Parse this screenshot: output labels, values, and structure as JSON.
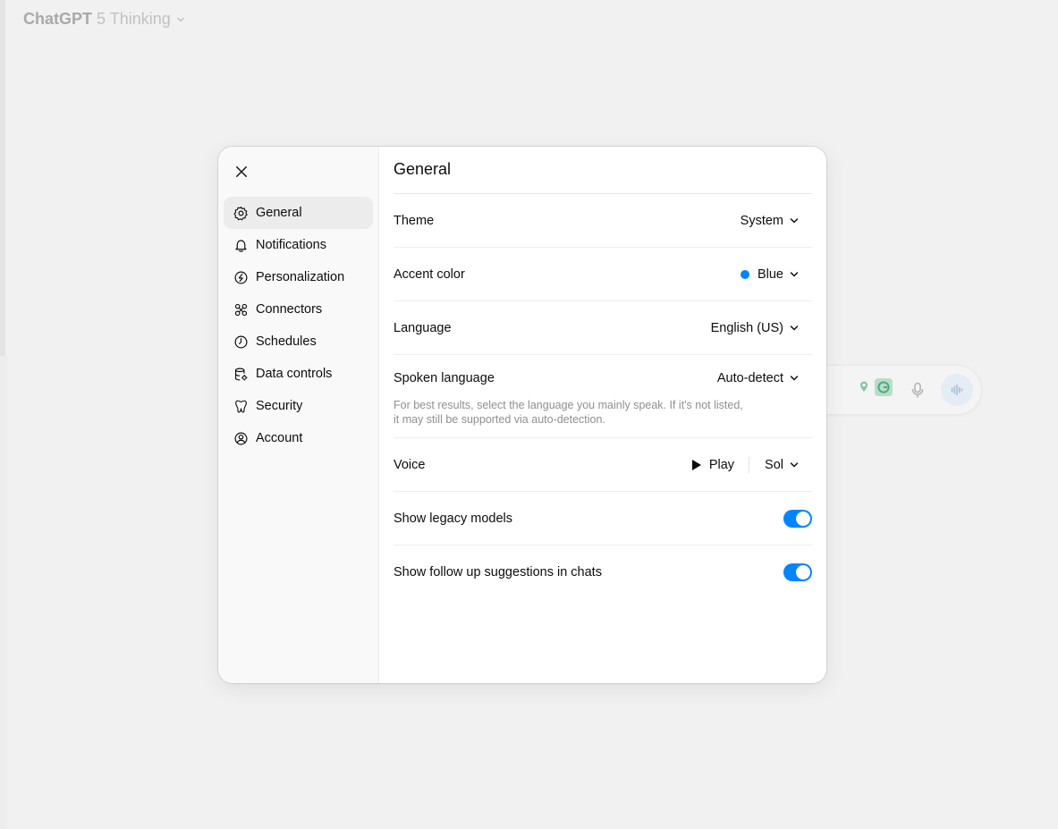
{
  "app": {
    "title": "ChatGPT",
    "model": "5 Thinking"
  },
  "settings": {
    "close_label": "Close",
    "nav": [
      {
        "label": "General",
        "icon": "gear-icon",
        "active": true
      },
      {
        "label": "Notifications",
        "icon": "bell-icon"
      },
      {
        "label": "Personalization",
        "icon": "personalization-icon"
      },
      {
        "label": "Connectors",
        "icon": "connectors-icon"
      },
      {
        "label": "Schedules",
        "icon": "clock-icon"
      },
      {
        "label": "Data controls",
        "icon": "database-gear-icon"
      },
      {
        "label": "Security",
        "icon": "security-icon"
      },
      {
        "label": "Account",
        "icon": "account-icon"
      }
    ],
    "title": "General",
    "theme": {
      "label": "Theme",
      "value": "System"
    },
    "accent": {
      "label": "Accent color",
      "value": "Blue",
      "color": "#0285ff"
    },
    "language": {
      "label": "Language",
      "value": "English (US)"
    },
    "spoken_language": {
      "label": "Spoken language",
      "value": "Auto-detect",
      "helper_line1": "For best results, select the language you mainly speak. If it's not listed,",
      "helper_line2": "it may still be supported via auto-detection."
    },
    "voice": {
      "label": "Voice",
      "play_label": "Play",
      "value": "Sol"
    },
    "legacy_models": {
      "label": "Show legacy models",
      "enabled": true
    },
    "follow_up": {
      "label": "Show follow up suggestions in chats",
      "enabled": true
    }
  }
}
